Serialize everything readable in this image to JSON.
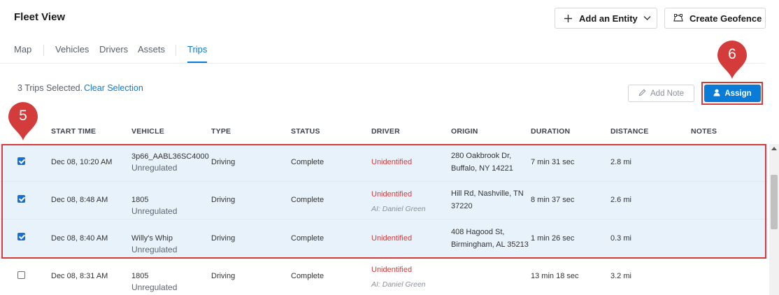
{
  "page": {
    "title": "Fleet View"
  },
  "header": {
    "add_entity_label": "Add an Entity",
    "create_geofence_label": "Create Geofence"
  },
  "tabs": [
    {
      "label": "Map",
      "active": false
    },
    {
      "label": "Vehicles",
      "active": false
    },
    {
      "label": "Drivers",
      "active": false
    },
    {
      "label": "Assets",
      "active": false
    },
    {
      "label": "Trips",
      "active": true
    }
  ],
  "selection": {
    "text": "3 Trips Selected.",
    "clear_label": "Clear Selection"
  },
  "actions": {
    "add_note_label": "Add Note",
    "assign_label": "Assign"
  },
  "markers": {
    "step_5": "5",
    "step_6": "6"
  },
  "table": {
    "columns": [
      "START TIME",
      "VEHICLE",
      "TYPE",
      "STATUS",
      "DRIVER",
      "ORIGIN",
      "DURATION",
      "DISTANCE",
      "NOTES"
    ],
    "rows": [
      {
        "checked": true,
        "start_time": "Dec 08, 10:20 AM",
        "vehicle": "3p66_AABL36SC4000",
        "vehicle_sub": "Unregulated",
        "type": "Driving",
        "status": "Complete",
        "driver": "Unidentified",
        "driver_ai": "",
        "origin_line1": "280 Oakbrook Dr,",
        "origin_line2": "Buffalo, NY 14221",
        "duration": "7 min 31 sec",
        "distance": "2.8 mi",
        "notes": ""
      },
      {
        "checked": true,
        "start_time": "Dec 08, 8:48 AM",
        "vehicle": "1805",
        "vehicle_sub": "Unregulated",
        "type": "Driving",
        "status": "Complete",
        "driver": "Unidentified",
        "driver_ai": "AI: Daniel Green",
        "origin_line1": "Hill Rd, Nashville, TN",
        "origin_line2": "37220",
        "duration": "8 min 37 sec",
        "distance": "2.6 mi",
        "notes": ""
      },
      {
        "checked": true,
        "start_time": "Dec 08, 8:40 AM",
        "vehicle": "Willy's Whip",
        "vehicle_sub": "Unregulated",
        "type": "Driving",
        "status": "Complete",
        "driver": "Unidentified",
        "driver_ai": "",
        "origin_line1": "408 Hagood St,",
        "origin_line2": "Birmingham, AL 35213",
        "duration": "1 min 26 sec",
        "distance": "0.3 mi",
        "notes": ""
      },
      {
        "checked": false,
        "start_time": "Dec 08, 8:31 AM",
        "vehicle": "1805",
        "vehicle_sub": "Unregulated",
        "type": "Driving",
        "status": "Complete",
        "driver": "Unidentified",
        "driver_ai": "AI: Daniel Green",
        "origin_line1": "",
        "origin_line2": "",
        "duration": "13 min 18 sec",
        "distance": "3.2 mi",
        "notes": ""
      }
    ]
  },
  "colors": {
    "accent": "#0b7bd8",
    "highlight": "#d43b3b",
    "selected_row": "#e8f2fb",
    "driver_alert": "#d53c3c"
  },
  "icons": [
    "plus-icon",
    "chevron-down-icon",
    "geofence-icon",
    "pencil-icon",
    "person-icon",
    "map-pin-marker-icon"
  ]
}
